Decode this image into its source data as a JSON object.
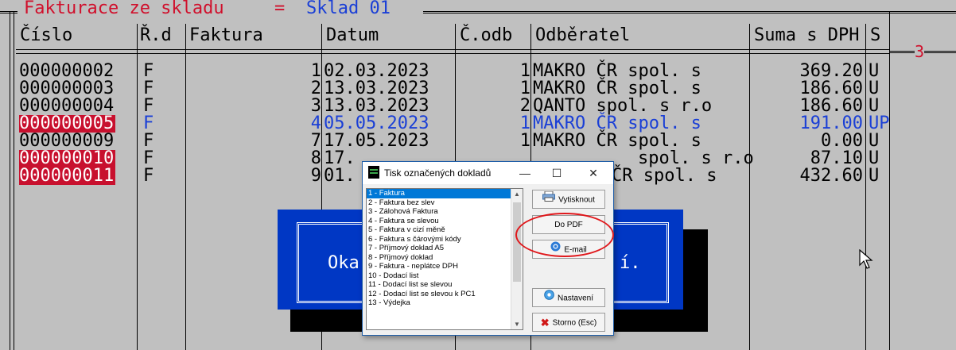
{
  "window": {
    "title_left": "Fakturace ze skladu",
    "title_eq": "=",
    "title_right": "Sklad 01",
    "badge": "3"
  },
  "columns": [
    {
      "key": "cislo",
      "label": "Číslo"
    },
    {
      "key": "rd",
      "label": "Ř.d"
    },
    {
      "key": "faktura",
      "label": "Faktura"
    },
    {
      "key": "datum",
      "label": "Datum"
    },
    {
      "key": "codb",
      "label": "Č.odb"
    },
    {
      "key": "odberatel",
      "label": "Odběratel"
    },
    {
      "key": "suma",
      "label": "Suma s DPH"
    },
    {
      "key": "s",
      "label": "S"
    }
  ],
  "rows": [
    {
      "cislo": "000000002",
      "rd": "F",
      "faktura": "1",
      "datum": "02.03.2023",
      "codb": "1",
      "odberatel": "MAKRO ČR spol. s",
      "suma": "369.20",
      "s": "U",
      "selected": false,
      "current": false
    },
    {
      "cislo": "000000003",
      "rd": "F",
      "faktura": "2",
      "datum": "13.03.2023",
      "codb": "1",
      "odberatel": "MAKRO ČR spol. s",
      "suma": "186.60",
      "s": "U",
      "selected": false,
      "current": false
    },
    {
      "cislo": "000000004",
      "rd": "F",
      "faktura": "3",
      "datum": "13.03.2023",
      "codb": "2",
      "odberatel": "QANTO spol. s r.o",
      "suma": "186.60",
      "s": "U",
      "selected": false,
      "current": false
    },
    {
      "cislo": "000000005",
      "rd": "F",
      "faktura": "4",
      "datum": "05.05.2023",
      "codb": "1",
      "odberatel": "MAKRO ČR spol. s",
      "suma": "191.00",
      "s": "UP",
      "selected": true,
      "current": true
    },
    {
      "cislo": "000000009",
      "rd": "F",
      "faktura": "7",
      "datum": "17.05.2023",
      "codb": "1",
      "odberatel": "MAKRO ČR spol. s",
      "suma": "0.00",
      "s": "U",
      "selected": false,
      "current": false
    },
    {
      "cislo": "000000010",
      "rd": "F",
      "faktura": "8",
      "datum": "17.",
      "codb": "",
      "odberatel": "spol. s r.o",
      "suma": "87.10",
      "s": "U",
      "selected": true,
      "current": false
    },
    {
      "cislo": "000000011",
      "rd": "F",
      "faktura": "9",
      "datum": "01.",
      "codb": "",
      "odberatel": "ČR spol. s",
      "suma": "432.60",
      "s": "U",
      "selected": true,
      "current": false
    }
  ],
  "background_dialog": {
    "left_text": "Oka",
    "right_text": "í."
  },
  "dialog": {
    "title": "Tisk označených dokladů",
    "minimize": "—",
    "maximize": "☐",
    "close": "✕",
    "list_items": [
      "1 - Faktura",
      "2 - Faktura bez slev",
      "3 - Zálohová Faktura",
      "4 - Faktura se slevou",
      "5 - Faktura v cizí měně",
      "6 - Faktura s čárovými kódy",
      "7 - Příjmový doklad A5",
      "8 - Příjmový doklad",
      "9 - Faktura - neplátce DPH",
      "10 - Dodací list",
      "11 - Dodací list se slevou",
      "12 - Dodací list se slevou k PC1",
      "13 - Výdejka"
    ],
    "selected_index": 0,
    "buttons": {
      "print": "Vytisknout",
      "pdf": "Do PDF",
      "email": "E-mail",
      "settings": "Nastavení",
      "cancel": "Storno (Esc)"
    }
  },
  "colors": {
    "terminal_bg": "#c0c0c0",
    "selected_row_bg": "#c8102e",
    "current_row_text": "#1a3fd6",
    "title_left": "#d0102c",
    "title_right": "#1a3fd6",
    "overlay_blue": "#0037c4",
    "highlight_ellipse": "#e0181c"
  }
}
